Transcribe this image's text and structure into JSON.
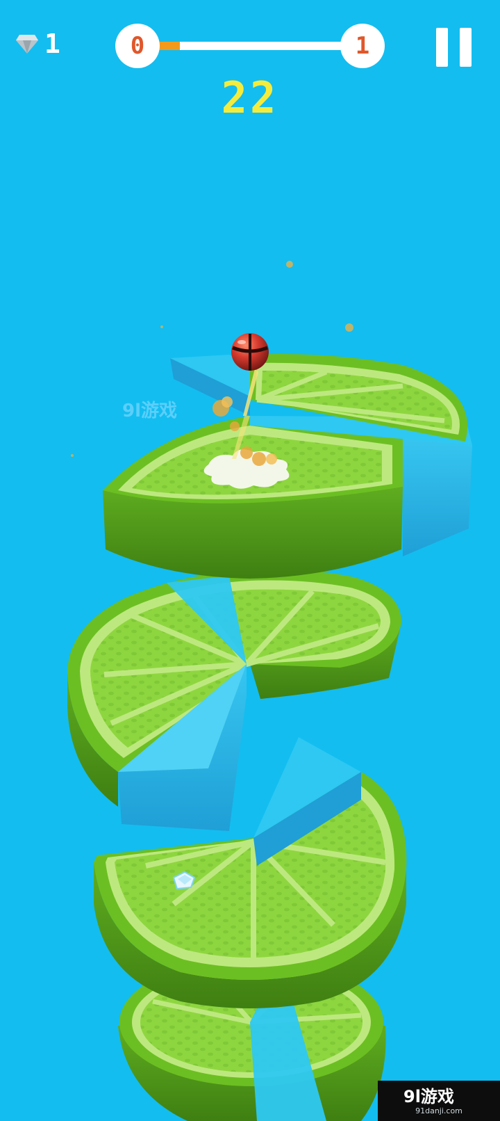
{
  "hud": {
    "gems": {
      "icon": "diamond-icon",
      "count": "1"
    },
    "progress": {
      "current_level": "0",
      "next_level": "1",
      "fraction": 0.15
    },
    "score": "22",
    "pause": {
      "icon": "pause-icon"
    }
  },
  "watermark": {
    "site": "91danji.com"
  },
  "colors": {
    "sky": "#13bdf0",
    "lime_rind": "#6cbf22",
    "lime_pith": "#bde87f",
    "lime_flesh": "#8ed63f",
    "danger_segment": "#2ec8f2",
    "ball": "#d63a2e",
    "score": "#f4ec3c",
    "progress_fill": "#f39a1c",
    "level_text": "#e0572b"
  }
}
